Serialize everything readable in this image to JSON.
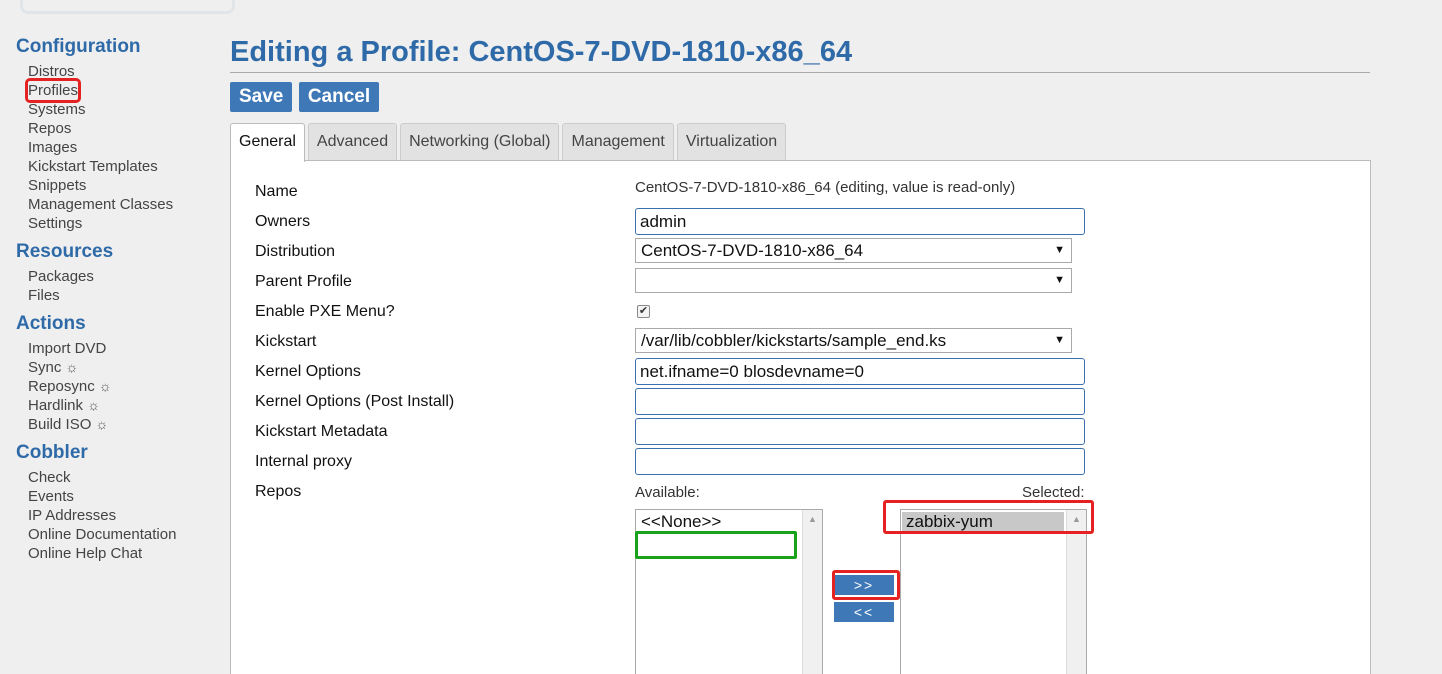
{
  "sidebar": {
    "configuration": {
      "title": "Configuration",
      "items": [
        "Distros",
        "Profiles",
        "Systems",
        "Repos",
        "Images",
        "Kickstart Templates",
        "Snippets",
        "Management Classes",
        "Settings"
      ]
    },
    "resources": {
      "title": "Resources",
      "items": [
        "Packages",
        "Files"
      ]
    },
    "actions": {
      "title": "Actions",
      "items": [
        "Import DVD",
        "Sync",
        "Reposync",
        "Hardlink",
        "Build ISO"
      ]
    },
    "cobbler": {
      "title": "Cobbler",
      "items": [
        "Check",
        "Events",
        "IP Addresses",
        "Online Documentation",
        "Online Help Chat"
      ]
    },
    "gear_glyph": "☼"
  },
  "page": {
    "title": "Editing a Profile: CentOS-7-DVD-1810-x86_64",
    "save_label": "Save",
    "cancel_label": "Cancel"
  },
  "tabs": [
    "General",
    "Advanced",
    "Networking (Global)",
    "Management",
    "Virtualization"
  ],
  "active_tab": "General",
  "form": {
    "name_label": "Name",
    "name_value": "CentOS-7-DVD-1810-x86_64 (editing, value is read-only)",
    "owners_label": "Owners",
    "owners_value": "admin",
    "distribution_label": "Distribution",
    "distribution_value": "CentOS-7-DVD-1810-x86_64",
    "parent_label": "Parent Profile",
    "parent_value": "",
    "pxe_label": "Enable PXE Menu?",
    "pxe_checked": true,
    "kickstart_label": "Kickstart",
    "kickstart_value": "/var/lib/cobbler/kickstarts/sample_end.ks",
    "kernel_label": "Kernel Options",
    "kernel_value": "net.ifname=0 blosdevname=0",
    "kernel_post_label": "Kernel Options (Post Install)",
    "kernel_post_value": "",
    "ks_meta_label": "Kickstart Metadata",
    "ks_meta_value": "",
    "proxy_label": "Internal proxy",
    "proxy_value": "",
    "repos_label": "Repos",
    "available_label": "Available:",
    "selected_label": "Selected:",
    "available_options": [
      "<<None>>"
    ],
    "selected_options": [
      "zabbix-yum"
    ],
    "add_label": ">>",
    "remove_label": "<<"
  },
  "colors": {
    "accent": "#3f78b6",
    "heading": "#2f6aa8",
    "annotation_red": "#e52222",
    "annotation_green": "#1aa31a"
  }
}
